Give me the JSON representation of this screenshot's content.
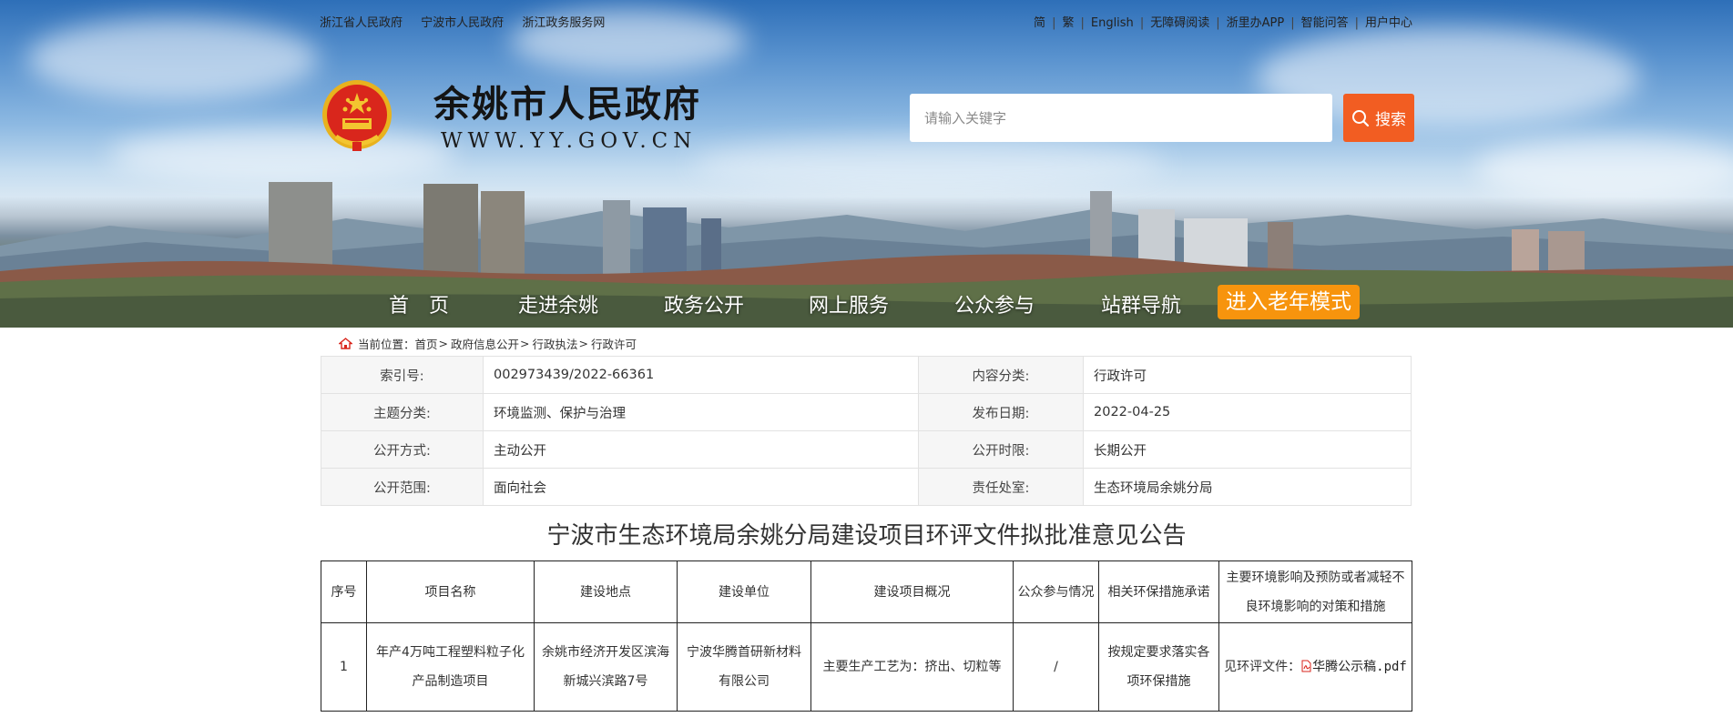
{
  "topbar": {
    "left_links": [
      "浙江省人民政府",
      "宁波市人民政府",
      "浙江政务服务网"
    ],
    "right_links": [
      "简",
      "繁",
      "English",
      "无障碍阅读",
      "浙里办APP",
      "智能问答",
      "用户中心"
    ]
  },
  "header": {
    "site_title": "余姚市人民政府",
    "site_domain": "WWW.YY.GOV.CN",
    "search_placeholder": "请输入关键字",
    "search_button": "搜索"
  },
  "nav": {
    "items": [
      "首　页",
      "走进余姚",
      "政务公开",
      "网上服务",
      "公众参与",
      "站群导航"
    ],
    "elder_mode": "进入老年模式"
  },
  "breadcrumb": {
    "label": "当前位置：",
    "items": [
      "首页",
      "政府信息公开",
      "行政执法",
      "行政许可"
    ],
    "separator": ">"
  },
  "info_table": {
    "rows": [
      {
        "k1": "索引号:",
        "v1": "002973439/2022-66361",
        "k2": "内容分类:",
        "v2": "行政许可"
      },
      {
        "k1": "主题分类:",
        "v1": "环境监测、保护与治理",
        "k2": "发布日期:",
        "v2": "2022-04-25"
      },
      {
        "k1": "公开方式:",
        "v1": "主动公开",
        "k2": "公开时限:",
        "v2": "长期公开"
      },
      {
        "k1": "公开范围:",
        "v1": "面向社会",
        "k2": "责任处室:",
        "v2": "生态环境局余姚分局"
      }
    ]
  },
  "document": {
    "title": "宁波市生态环境局余姚分局建设项目环评文件拟批准意见公告"
  },
  "project_table": {
    "headers": [
      "序号",
      "项目名称",
      "建设地点",
      "建设单位",
      "建设项目概况",
      "公众参与情况",
      "相关环保措施承诺",
      "主要环境影响及预防或者减轻不良环境影响的对策和措施"
    ],
    "rows": [
      {
        "no": "1",
        "name": "年产4万吨工程塑料粒子化产品制造项目",
        "location": "余姚市经济开发区滨海新城兴滨路7号",
        "unit": "宁波华腾首研新材料有限公司",
        "overview": "主要生产工艺为：挤出、切粒等",
        "public": "/",
        "commitment": "按规定要求落实各项环保措施",
        "measures_prefix": "见环评文件：",
        "measures_file": "华腾公示稿.pdf"
      }
    ]
  },
  "colors": {
    "search_button": "#f25d22",
    "elder_button": "#f7940d",
    "info_key_bg": "#f6f6f6"
  },
  "icons": [
    "emblem-icon",
    "search-icon",
    "home-icon",
    "pdf-icon"
  ]
}
